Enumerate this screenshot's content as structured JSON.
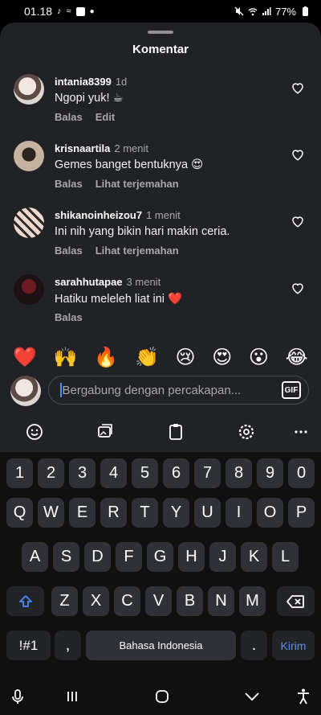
{
  "status": {
    "time": "01.18",
    "battery": "77%"
  },
  "sheet": {
    "title": "Komentar"
  },
  "comments": [
    {
      "user": "intania8399",
      "time": "1d",
      "text": "Ngopi yuk! ☕",
      "actions": [
        "Balas",
        "Edit"
      ]
    },
    {
      "user": "krisnaartila",
      "time": "2 menit",
      "text": "Gemes banget bentuknya 😍",
      "actions": [
        "Balas",
        "Lihat terjemahan"
      ]
    },
    {
      "user": "shikanoinheizou7",
      "time": "1 menit",
      "text": "Ini nih yang bikin hari makin ceria.",
      "actions": [
        "Balas",
        "Lihat terjemahan"
      ]
    },
    {
      "user": "sarahhutapae",
      "time": "3 menit",
      "text": "Hatiku meleleh liat ini ❤️",
      "actions": [
        "Balas"
      ]
    }
  ],
  "emojis": [
    "❤️",
    "🙌",
    "🔥",
    "👏",
    "😢",
    "😍",
    "😮",
    "😂"
  ],
  "input": {
    "placeholder": "Bergabung dengan percakapan...",
    "gif_label": "GIF"
  },
  "keyboard": {
    "row_numbers": [
      "1",
      "2",
      "3",
      "4",
      "5",
      "6",
      "7",
      "8",
      "9",
      "0"
    ],
    "row1": [
      "Q",
      "W",
      "E",
      "R",
      "T",
      "Y",
      "U",
      "I",
      "O",
      "P"
    ],
    "row2": [
      "A",
      "S",
      "D",
      "F",
      "G",
      "H",
      "J",
      "K",
      "L"
    ],
    "row3": [
      "Z",
      "X",
      "C",
      "V",
      "B",
      "N",
      "M"
    ],
    "symbols_key": "!#1",
    "comma_key": ",",
    "space_label": "Bahasa Indonesia",
    "period_key": ".",
    "send_label": "Kirim"
  }
}
